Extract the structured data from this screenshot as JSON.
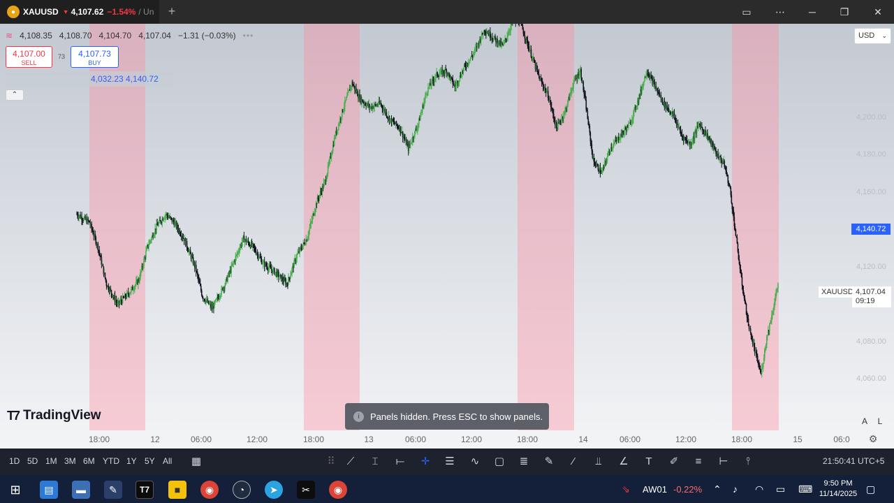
{
  "tab": {
    "icon": "gold-coin-icon",
    "symbol": "XAUUSD",
    "arrow": "▼",
    "price": "4,107.62",
    "change": "−1.54%",
    "rest": "/ Un"
  },
  "window_controls": [
    "layout-icon",
    "more-icon",
    "minimize-icon",
    "restore-icon",
    "close-icon"
  ],
  "legend": {
    "open": "4,108.35",
    "high": "4,108.70",
    "low": "4,104.70",
    "close": "4,107.04",
    "change": "−1.31 (−0.03%)",
    "more": "•••"
  },
  "trade": {
    "sell_price": "4,107.00",
    "sell_label": "SELL",
    "spread": "73",
    "buy_price": "4,107.73",
    "buy_label": "BUY"
  },
  "range_values": "4,032.23  4,140.72",
  "currency": "USD",
  "y_axis": [
    "4,200.00",
    "4,180.00",
    "4,160.00",
    "4,120.00",
    "4,080.00",
    "4,060.00"
  ],
  "price_tag": "4,140.72",
  "last_price": {
    "symbol": "XAUUSD",
    "price": "4,107.04",
    "countdown": "09:19"
  },
  "x_axis": [
    "18:00",
    "12",
    "06:00",
    "12:00",
    "18:00",
    "13",
    "06:00",
    "12:00",
    "18:00",
    "14",
    "06:00",
    "12:00",
    "18:00",
    "15",
    "06:0"
  ],
  "logo_text": "TradingView",
  "toast": "Panels hidden. Press ESC to show panels.",
  "corner_buttons": [
    "A",
    "L"
  ],
  "ranges": [
    "1D",
    "5D",
    "1M",
    "3M",
    "6M",
    "YTD",
    "1Y",
    "5Y",
    "All"
  ],
  "clock": "21:50:41 UTC+5",
  "tray": {
    "ticker": "AW01",
    "ticker_change": "-0.22%",
    "time": "9:50 PM",
    "date": "11/14/2025"
  },
  "colors": {
    "up": "#26a69a",
    "green_candle": "#4caf50",
    "down": "#131722",
    "session": "#f6a0b0",
    "accent": "#2962ff",
    "sell": "#f23645"
  },
  "chart_data": {
    "type": "candlestick",
    "symbol": "XAUUSD",
    "y_range": [
      4040,
      4230
    ],
    "price_path": [
      [
        0,
        4144
      ],
      [
        18,
        4140
      ],
      [
        30,
        4128
      ],
      [
        42,
        4110
      ],
      [
        58,
        4100
      ],
      [
        75,
        4106
      ],
      [
        88,
        4112
      ],
      [
        100,
        4128
      ],
      [
        113,
        4138
      ],
      [
        126,
        4144
      ],
      [
        138,
        4140
      ],
      [
        152,
        4132
      ],
      [
        168,
        4118
      ],
      [
        178,
        4104
      ],
      [
        192,
        4098
      ],
      [
        210,
        4110
      ],
      [
        224,
        4122
      ],
      [
        236,
        4132
      ],
      [
        250,
        4128
      ],
      [
        264,
        4120
      ],
      [
        280,
        4116
      ],
      [
        298,
        4110
      ],
      [
        312,
        4124
      ],
      [
        326,
        4132
      ],
      [
        340,
        4150
      ],
      [
        352,
        4160
      ],
      [
        366,
        4182
      ],
      [
        378,
        4196
      ],
      [
        390,
        4208
      ],
      [
        402,
        4200
      ],
      [
        416,
        4196
      ],
      [
        430,
        4198
      ],
      [
        444,
        4190
      ],
      [
        458,
        4186
      ],
      [
        470,
        4176
      ],
      [
        484,
        4188
      ],
      [
        496,
        4204
      ],
      [
        510,
        4212
      ],
      [
        524,
        4214
      ],
      [
        536,
        4206
      ],
      [
        550,
        4216
      ],
      [
        562,
        4222
      ],
      [
        578,
        4234
      ],
      [
        590,
        4230
      ],
      [
        604,
        4226
      ],
      [
        618,
        4238
      ],
      [
        628,
        4238
      ],
      [
        644,
        4222
      ],
      [
        656,
        4210
      ],
      [
        668,
        4202
      ],
      [
        680,
        4186
      ],
      [
        692,
        4194
      ],
      [
        704,
        4208
      ],
      [
        714,
        4214
      ],
      [
        722,
        4196
      ],
      [
        732,
        4170
      ],
      [
        744,
        4164
      ],
      [
        756,
        4176
      ],
      [
        770,
        4182
      ],
      [
        784,
        4188
      ],
      [
        796,
        4200
      ],
      [
        808,
        4214
      ],
      [
        820,
        4206
      ],
      [
        832,
        4198
      ],
      [
        846,
        4192
      ],
      [
        858,
        4182
      ],
      [
        870,
        4178
      ],
      [
        882,
        4188
      ],
      [
        894,
        4182
      ],
      [
        906,
        4174
      ],
      [
        918,
        4168
      ],
      [
        926,
        4156
      ],
      [
        934,
        4134
      ],
      [
        942,
        4112
      ],
      [
        952,
        4090
      ],
      [
        962,
        4076
      ],
      [
        970,
        4066
      ],
      [
        978,
        4084
      ],
      [
        986,
        4096
      ],
      [
        994,
        4110
      ]
    ]
  }
}
